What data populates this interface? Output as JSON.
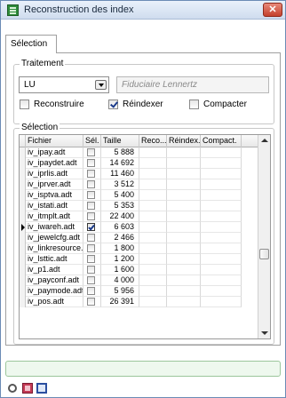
{
  "window": {
    "title": "Reconstruction des index",
    "close_label": "✕"
  },
  "tabs": [
    {
      "label": "Sélection",
      "active": true
    }
  ],
  "treatment": {
    "group_label": "Traitement",
    "combo_value": "LU",
    "client_name": "Fiduciaire Lennertz",
    "options": [
      {
        "label": "Reconstruire",
        "checked": false
      },
      {
        "label": "Réindexer",
        "checked": true
      },
      {
        "label": "Compacter",
        "checked": false
      }
    ]
  },
  "selection": {
    "group_label": "Sélection",
    "columns": [
      "Fichier",
      "Sél.",
      "Taille",
      "Reco...",
      "Réindex.",
      "Compact."
    ],
    "rows": [
      {
        "file": "iv_ipay.adt",
        "selected": false,
        "size": "5 888"
      },
      {
        "file": "iv_ipaydet.adt",
        "selected": false,
        "size": "14 692"
      },
      {
        "file": "iv_iprlis.adt",
        "selected": false,
        "size": "11 460"
      },
      {
        "file": "iv_iprver.adt",
        "selected": false,
        "size": "3 512"
      },
      {
        "file": "iv_isptva.adt",
        "selected": false,
        "size": "5 400"
      },
      {
        "file": "iv_istati.adt",
        "selected": false,
        "size": "5 353"
      },
      {
        "file": "iv_itmplt.adt",
        "selected": false,
        "size": "22 400"
      },
      {
        "file": "iv_iwareh.adt",
        "selected": true,
        "size": "6 603",
        "current": true
      },
      {
        "file": "iv_jewelcfg.adt",
        "selected": false,
        "size": "2 466"
      },
      {
        "file": "iv_linkresource.a",
        "selected": false,
        "size": "1 800"
      },
      {
        "file": "iv_lsttic.adt",
        "selected": false,
        "size": "1 200"
      },
      {
        "file": "iv_p1.adt",
        "selected": false,
        "size": "1 600"
      },
      {
        "file": "iv_payconf.adt",
        "selected": false,
        "size": "4 000"
      },
      {
        "file": "iv_paymode.adt",
        "selected": false,
        "size": "5 956"
      },
      {
        "file": "iv_pos.adt",
        "selected": false,
        "size": "26 391"
      }
    ]
  },
  "colors": {
    "accent": "#2e8b3a",
    "status_bg": "#eef8ee",
    "status_border": "#9cc69c"
  },
  "footer_icons": [
    "tools-icon",
    "book-icon",
    "window-icon"
  ]
}
